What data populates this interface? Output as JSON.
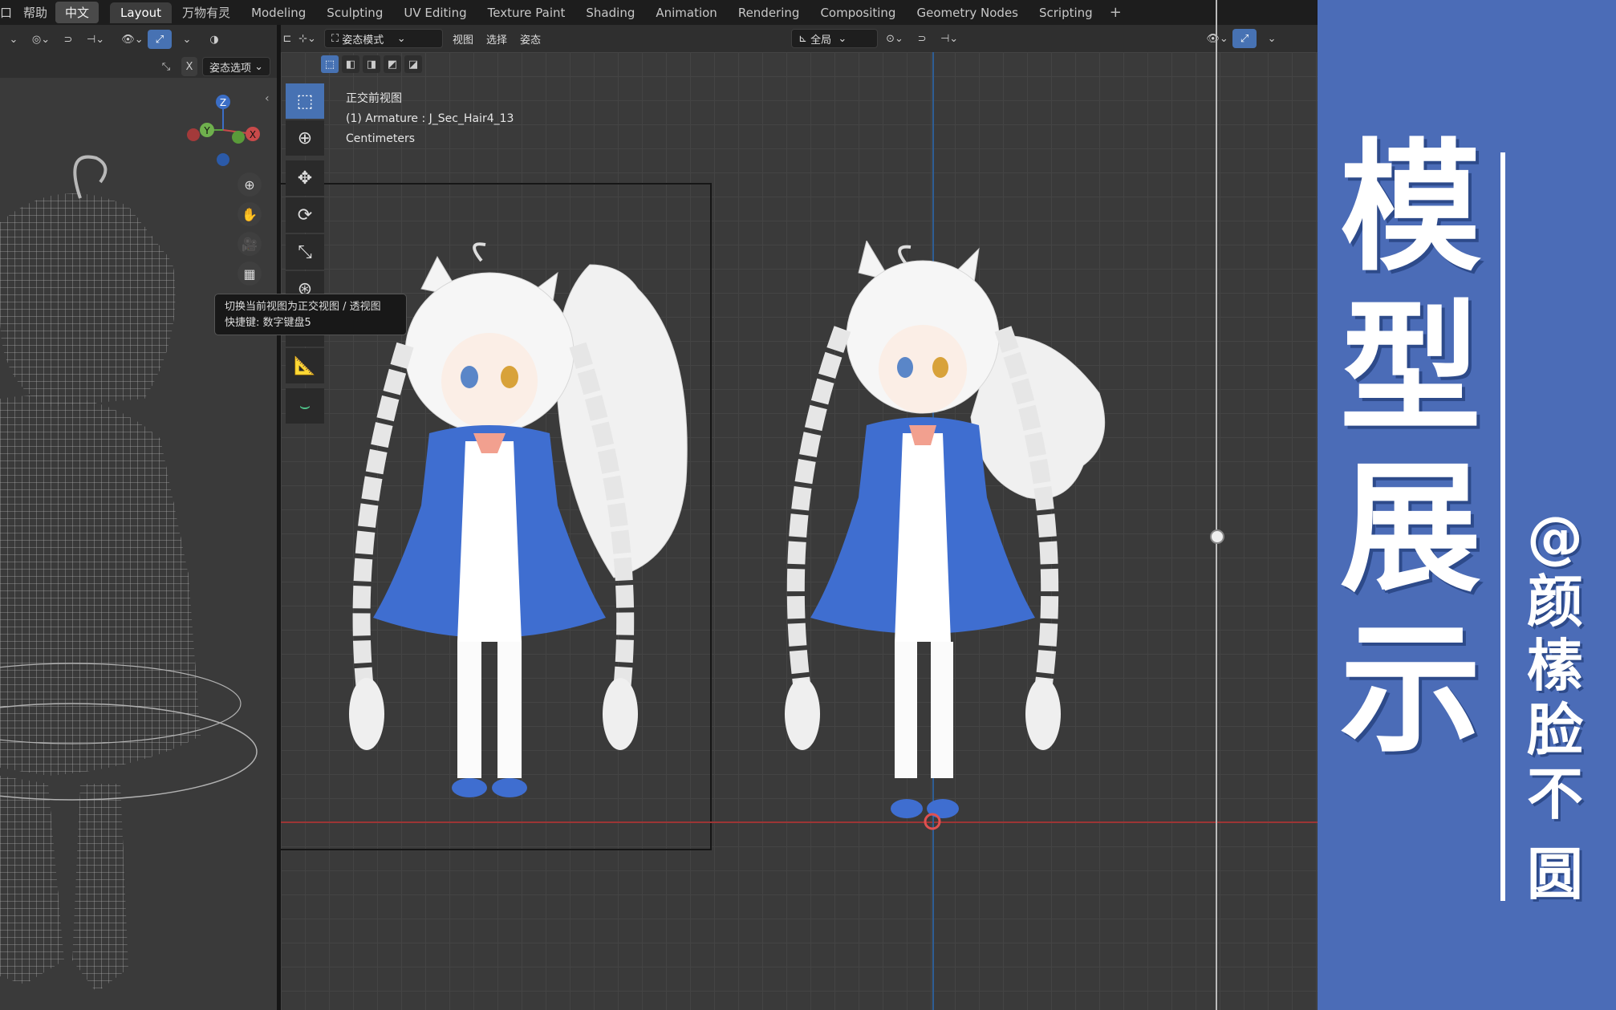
{
  "topbar": {
    "menu_partial": "口",
    "help": "帮助",
    "language": "中文",
    "workspace_tabs": [
      {
        "label": "Layout",
        "active": true
      },
      {
        "label": "万物有灵",
        "active": false
      },
      {
        "label": "Modeling",
        "active": false
      },
      {
        "label": "Sculpting",
        "active": false
      },
      {
        "label": "UV Editing",
        "active": false
      },
      {
        "label": "Texture Paint",
        "active": false
      },
      {
        "label": "Shading",
        "active": false
      },
      {
        "label": "Animation",
        "active": false
      },
      {
        "label": "Rendering",
        "active": false
      },
      {
        "label": "Compositing",
        "active": false
      },
      {
        "label": "Geometry Nodes",
        "active": false
      },
      {
        "label": "Scripting",
        "active": false
      }
    ],
    "add_tab": "+"
  },
  "left_header": {
    "x_button": "X",
    "pose_options": "姿态选项"
  },
  "viewport_header": {
    "mode": "姿态模式",
    "menus": [
      "视图",
      "选择",
      "姿态"
    ],
    "orientation": "全局"
  },
  "viewport_info": {
    "view_name": "正交前视图",
    "object": "(1) Armature : J_Sec_Hair4_13",
    "units": "Centimeters"
  },
  "tooltip": {
    "line1": "切换当前视图为正交视图 / 透视图",
    "line2": "快捷键: 数字键盘5"
  },
  "gizmo": {
    "z": "Z",
    "y": "Y",
    "x": "X"
  },
  "banner": {
    "title_chars": [
      "模",
      "型",
      "展",
      "示"
    ],
    "author_chars": [
      "@",
      "颜",
      "榡",
      "脸",
      "不",
      "圆"
    ],
    "bg_color": "#4b6cb7"
  },
  "colors": {
    "accent": "#4772b3",
    "dress_blue": "#3f6ed0",
    "grid_red": "#9c3535",
    "grid_blue": "#2f5e95"
  }
}
